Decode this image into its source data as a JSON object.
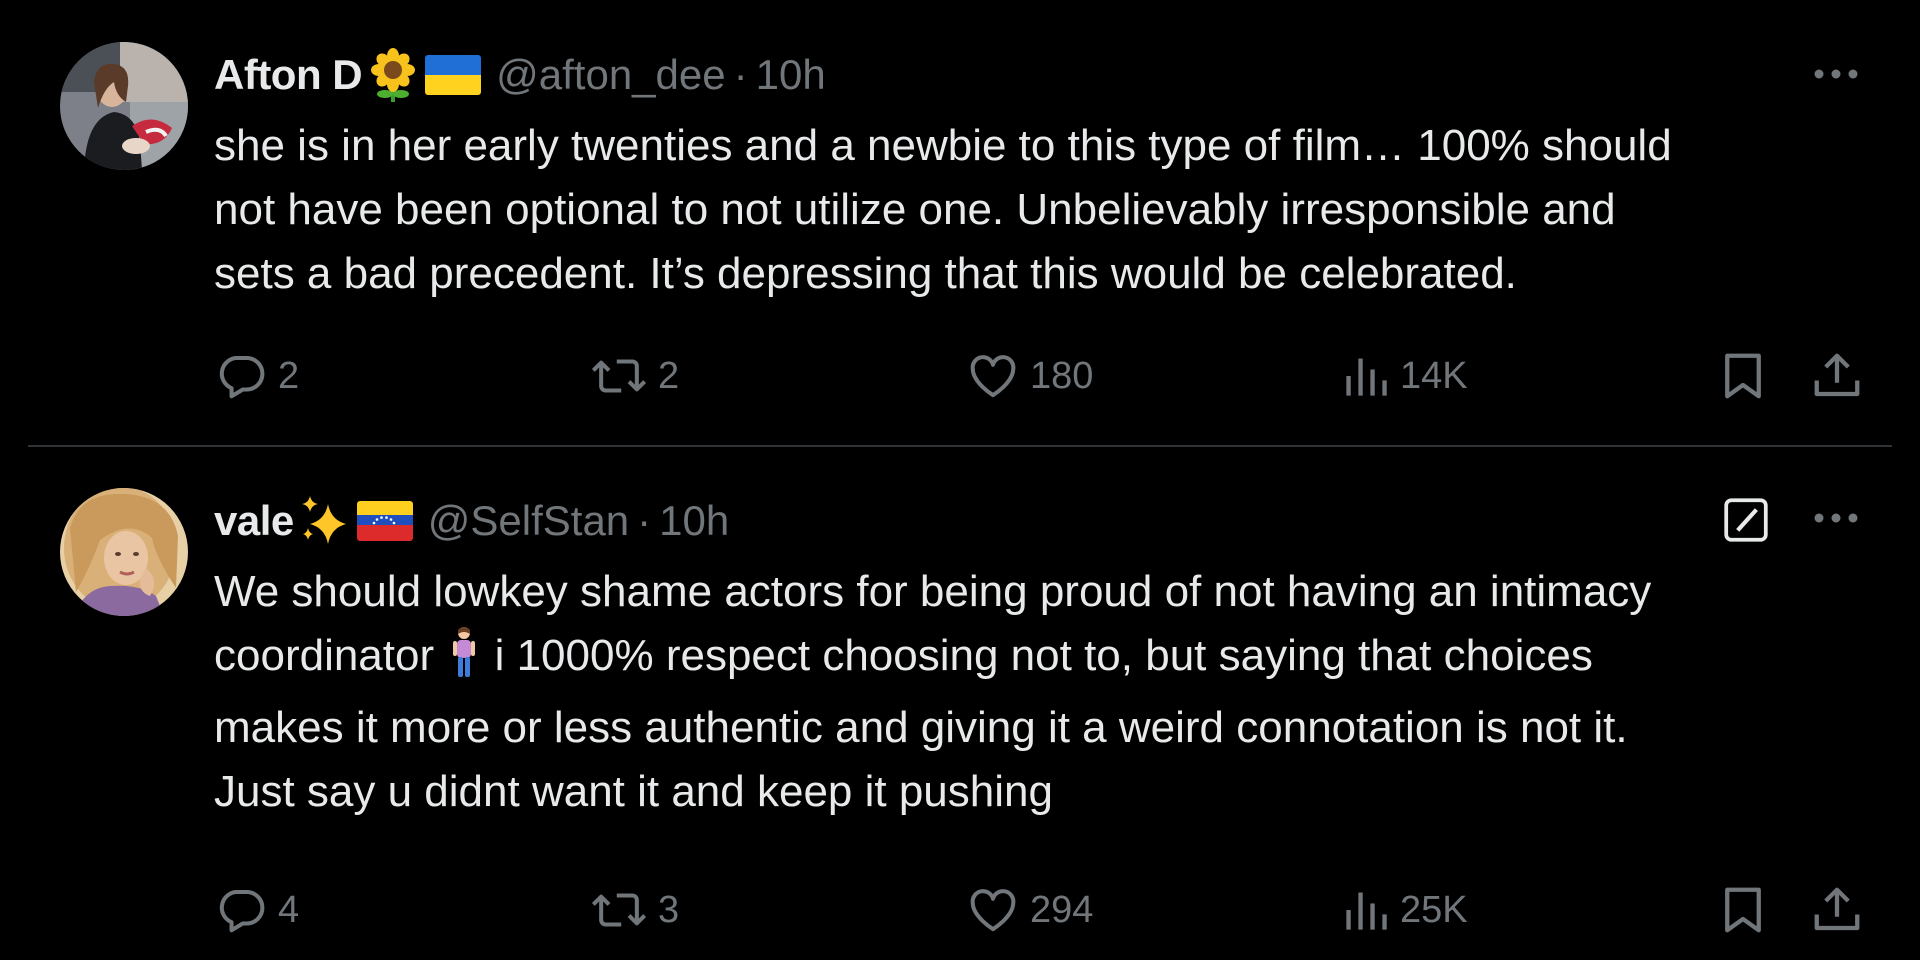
{
  "colors": {
    "background": "#000000",
    "text_primary": "#e7e9ea",
    "text_secondary": "#71767b",
    "divider": "#2f3336"
  },
  "tweets": [
    {
      "display_name": "Afton D",
      "name_emojis": [
        "sunflower-emoji",
        "ukraine-flag-emoji"
      ],
      "handle": "@afton_dee",
      "separator": "·",
      "time": "10h",
      "text": "she is in her early twenties and a newbie to this type of film… 100% should\nnot have been optional to not utilize one. Unbelievably irresponsible and\nsets a bad precedent. It’s depressing that this would be celebrated.",
      "replies": "2",
      "retweets": "2",
      "likes": "180",
      "views": "14K",
      "icons": {
        "more": "more-icon",
        "reply": "reply-icon",
        "retweet": "retweet-icon",
        "like": "heart-icon",
        "views": "views-icon",
        "bookmark": "bookmark-icon",
        "share": "share-icon"
      }
    },
    {
      "display_name": "vale",
      "name_emojis": [
        "sparkles-emoji",
        "venezuela-flag-emoji"
      ],
      "handle": "@SelfStan",
      "separator": "·",
      "time": "10h",
      "text_before_emoji": "We should lowkey shame actors for being proud of not having an intimacy\ncoordinator ",
      "text_emoji": "person-standing-emoji",
      "text_after_emoji": " i 1000% respect choosing not to, but saying that choices\nmakes it more or less authentic and giving it a weird connotation is not it.\nJust say u didnt want it and keep it pushing",
      "replies": "4",
      "retweets": "3",
      "likes": "294",
      "views": "25K",
      "icons": {
        "grok": "grok-icon",
        "more": "more-icon",
        "reply": "reply-icon",
        "retweet": "retweet-icon",
        "like": "heart-icon",
        "views": "views-icon",
        "bookmark": "bookmark-icon",
        "share": "share-icon"
      }
    }
  ]
}
